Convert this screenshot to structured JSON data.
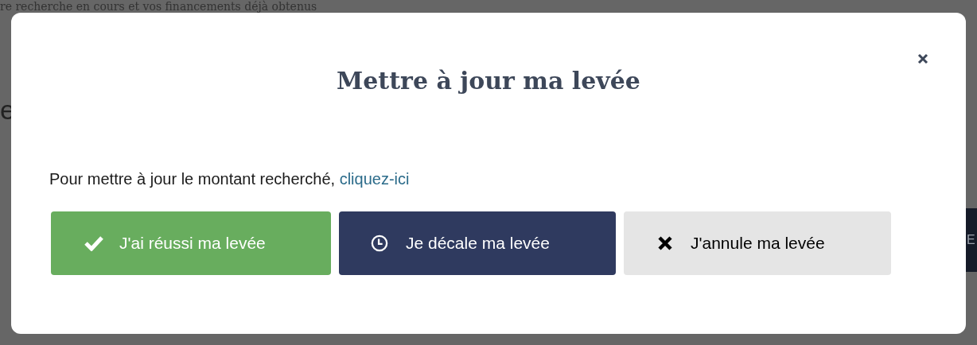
{
  "background": {
    "heading": "re recherche en cours et vos financements déjà obtenus",
    "side_text": "e",
    "side_button": "E"
  },
  "modal": {
    "title": "Mettre à jour ma levée",
    "message": "Pour mettre à jour le montant recherché,",
    "link": "cliquez-ici",
    "buttons": [
      {
        "kind": "success",
        "label": "J'ai réussi ma levée"
      },
      {
        "kind": "postpone",
        "label": "Je décale ma levée"
      },
      {
        "kind": "cancel",
        "label": "J'annule ma levée"
      }
    ]
  }
}
